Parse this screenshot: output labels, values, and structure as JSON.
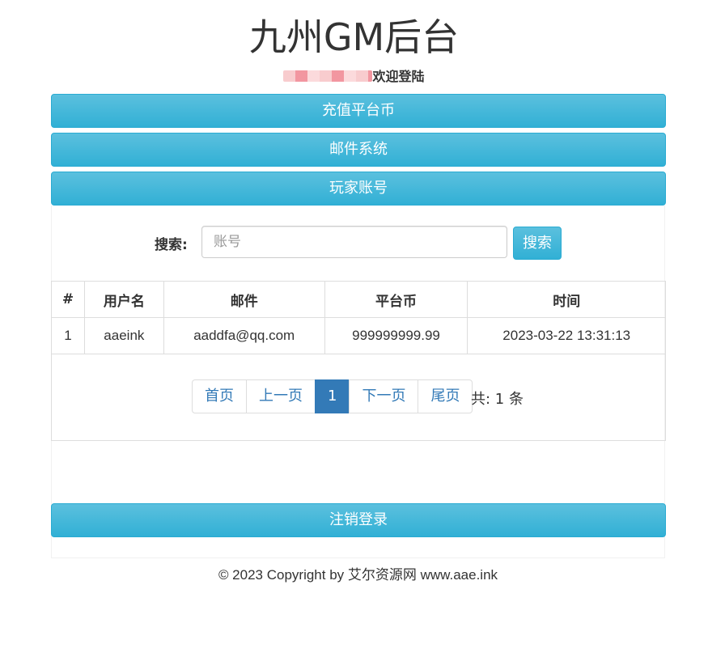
{
  "header": {
    "title": "九州GM后台",
    "welcome": "欢迎登陆"
  },
  "nav": {
    "recharge": "充值平台币",
    "mail": "邮件系统",
    "players": "玩家账号",
    "logout": "注销登录"
  },
  "search": {
    "label": "搜索:",
    "placeholder": "账号",
    "button": "搜索"
  },
  "table": {
    "headers": [
      "#",
      "用户名",
      "邮件",
      "平台币",
      "时间"
    ],
    "rows": [
      [
        "1",
        "aaeink",
        "aaddfa@qq.com",
        "999999999.99",
        "2023-03-22 13:31:13"
      ]
    ]
  },
  "pagination": {
    "first": "首页",
    "prev": "上一页",
    "current": "1",
    "next": "下一页",
    "last": "尾页",
    "total": "共: 1 条"
  },
  "footer": {
    "copyright": "© 2023 Copyright by 艾尔资源网 www.aae.ink"
  },
  "colors": {
    "info_button": "#5bc0de",
    "primary": "#337ab7"
  }
}
